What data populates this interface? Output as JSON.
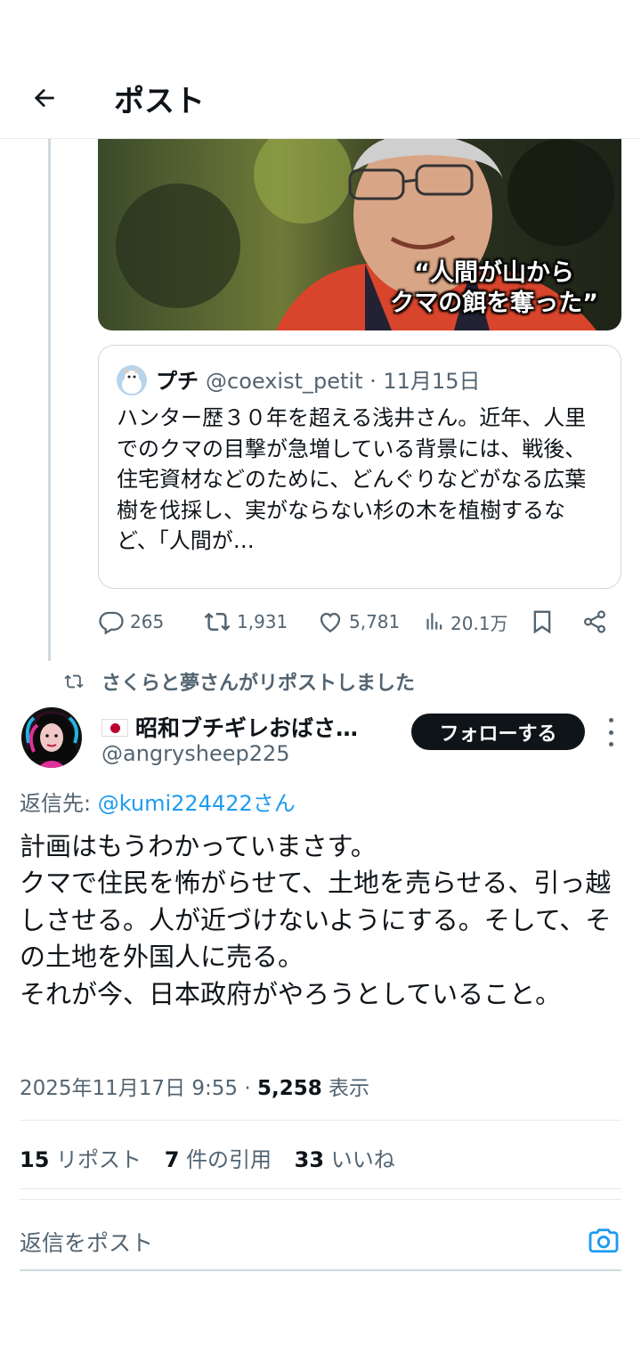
{
  "header": {
    "title": "ポスト"
  },
  "media": {
    "caption_line1": "“人間が山から",
    "caption_line2": "クマの餌を奪った”"
  },
  "quote": {
    "name": "プチ",
    "meta": "@coexist_petit · 11月15日",
    "text": "ハンター歴３０年を超える浅井さん。近年、人里でのクマの目撃が急増している背景には、戦後、住宅資材などのために、どんぐりなどがなる広葉樹を伐採し、実がならない杉の木を植樹するなど、「人間が…"
  },
  "actions": {
    "replies": "265",
    "reposts": "1,931",
    "likes": "5,781",
    "views": "20.1万"
  },
  "repost_label": "さくらと夢さんがリポストしました",
  "post": {
    "author_name": "昭和ブチギレおばさ…",
    "author_handle": "@angrysheep225",
    "follow_label": "フォローする",
    "reply_to_label": "返信先: ",
    "reply_to_mention": "@kumi224422さん",
    "text": "計画はもうわかっていまさす。\nクマで住民を怖がらせて、土地を売らせる、引っ越しさせる。人が近づけないようにする。そして、その土地を外国人に売る。\nそれが今、日本政府がやろうとしていること。",
    "timestamp": "2025年11月17日 9:55 · ",
    "view_count": "5,258",
    "view_label": " 表示"
  },
  "stats": {
    "reposts_count": "15",
    "reposts_label": " リポスト",
    "quotes_count": "7",
    "quotes_label": " 件の引用",
    "likes_count": "33",
    "likes_label": " いいね"
  },
  "reply_box": {
    "placeholder": "返信をポスト"
  },
  "colors": {
    "accent": "#1d9bf0",
    "text": "#0f1419",
    "muted": "#536471",
    "border": "#cfd9de"
  },
  "icons": [
    "back-arrow-icon",
    "reply-icon",
    "repost-icon",
    "like-icon",
    "views-icon",
    "bookmark-icon",
    "share-icon",
    "more-icon",
    "camera-icon"
  ]
}
